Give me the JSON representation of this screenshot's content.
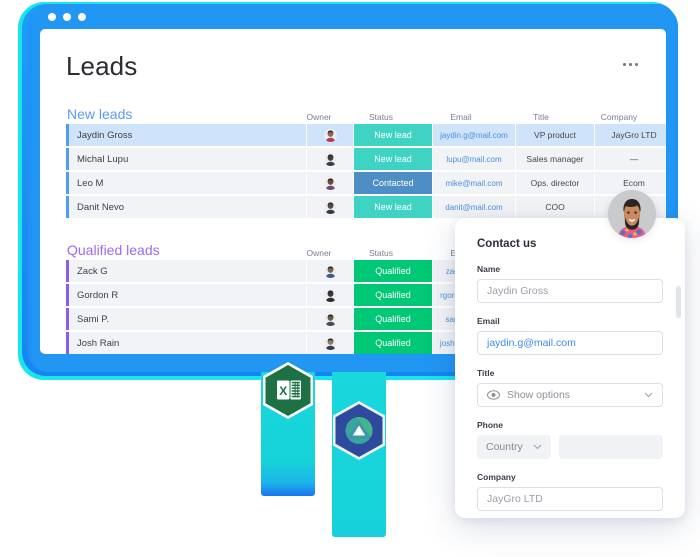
{
  "window": {
    "traffic_lights": [
      "close",
      "minimize",
      "maximize"
    ]
  },
  "header": {
    "title": "Leads",
    "menu_icon": "kebab-menu-icon"
  },
  "table": {
    "columns": [
      "Owner",
      "Status",
      "Email",
      "Title",
      "Company"
    ],
    "add_column_icon": "plus-circle-icon",
    "groups": [
      {
        "name": "New leads",
        "accent": "#4f9cf4",
        "title_color": "#5b9bf8",
        "rows": [
          {
            "name": "Jaydin Gross",
            "owner_icon": "avatar-icon",
            "status": "New lead",
            "status_color": "#3fd3c4",
            "email": "jaydin.g@mail.com",
            "title": "VP product",
            "company": "JayGro LTD",
            "selected": true
          },
          {
            "name": "Michal Lupu",
            "owner_icon": "avatar-icon",
            "status": "New lead",
            "status_color": "#3fd3c4",
            "email": "lupu@mail.com",
            "title": "Sales manager",
            "company": "—",
            "selected": false
          },
          {
            "name": "Leo M",
            "owner_icon": "avatar-icon",
            "status": "Contacted",
            "status_color": "#4d8fc4",
            "email": "mike@mail.com",
            "title": "Ops. director",
            "company": "Ecom",
            "selected": false
          },
          {
            "name": "Danit Nevo",
            "owner_icon": "avatar-icon",
            "status": "New lead",
            "status_color": "#3fd3c4",
            "email": "danit@mail.com",
            "title": "COO",
            "company": "—",
            "selected": false
          }
        ]
      },
      {
        "name": "Qualified leads",
        "accent": "#8a5cf0",
        "title_color": "#9b6bf2",
        "rows": [
          {
            "name": "Zack G",
            "owner_icon": "avatar-icon",
            "status": "Qualified",
            "status_color": "#00c875",
            "email": "zack@mail.com",
            "title": "",
            "company": "",
            "selected": false
          },
          {
            "name": "Gordon R",
            "owner_icon": "avatar-icon",
            "status": "Qualified",
            "status_color": "#00c875",
            "email": "rgordon@mail.com",
            "title": "",
            "company": "",
            "selected": false
          },
          {
            "name": "Sami P.",
            "owner_icon": "avatar-icon",
            "status": "Qualified",
            "status_color": "#00c875",
            "email": "sami@mail.com",
            "title": "",
            "company": "",
            "selected": false
          },
          {
            "name": "Josh Rain",
            "owner_icon": "avatar-icon",
            "status": "Qualified",
            "status_color": "#00c875",
            "email": "joshrain@mail.com",
            "title": "",
            "company": "",
            "selected": false
          }
        ]
      }
    ]
  },
  "contact_form": {
    "title": "Contact us",
    "avatar_icon": "user-photo-avatar",
    "fields": {
      "name_label": "Name",
      "name_value": "Jaydin Gross",
      "email_label": "Email",
      "email_value": "jaydin.g@mail.com",
      "title_label": "Title",
      "title_value": "Show options",
      "title_icon": "eye-icon",
      "title_chevron": "chevron-down-icon",
      "phone_label": "Phone",
      "phone_country_value": "Country",
      "phone_country_chevron": "chevron-down-icon",
      "phone_number_value": "",
      "company_label": "Company",
      "company_value": "JayGro LTD"
    }
  },
  "integrations": [
    {
      "name": "excel",
      "icon": "excel-hexagon-icon",
      "letter": "X",
      "color": "#1d7145"
    },
    {
      "name": "drive",
      "icon": "drive-hexagon-icon",
      "color": "#2e4a9e"
    }
  ],
  "colors": {
    "browser_chrome": "#2196f3",
    "glow_teal": "#18e6ed",
    "bar_teal": "#19d7dd",
    "status_new": "#3fd3c4",
    "status_contacted": "#4d8fc4",
    "status_qualified": "#00c875",
    "group_blue": "#5b9bf8",
    "group_purple": "#9b6bf2",
    "link_blue": "#4a90e2"
  }
}
